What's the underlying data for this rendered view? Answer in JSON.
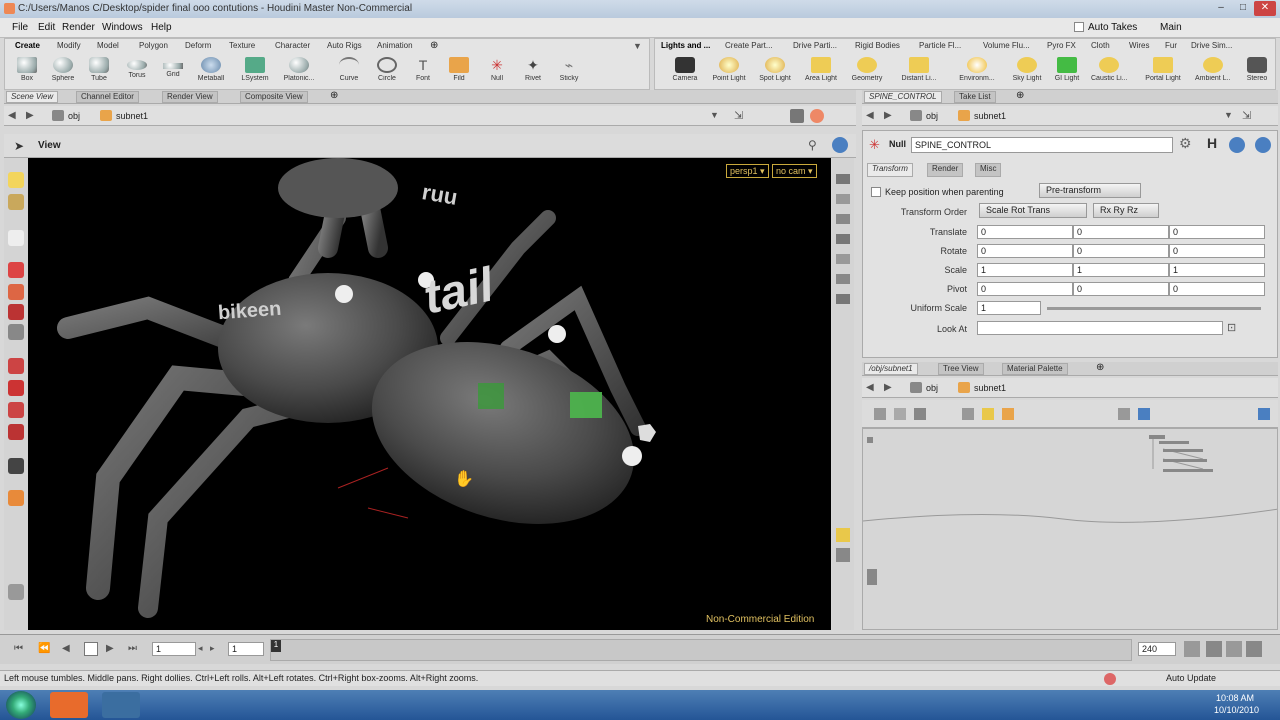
{
  "window": {
    "title": "C:/Users/Manos C/Desktop/spider final ooo contutions - Houdini Master Non-Commercial",
    "controls": [
      "–",
      "□",
      "✕"
    ]
  },
  "menubar": {
    "items": [
      "File",
      "Edit",
      "Render",
      "Windows",
      "Help"
    ],
    "auto_takes": "Auto Takes",
    "main": "Main"
  },
  "shelf_left": {
    "tabs": [
      "Create",
      "Modify",
      "Model",
      "Polygon",
      "Deform",
      "Texture",
      "Character",
      "Auto Rigs",
      "Animation"
    ],
    "tools": [
      "Box",
      "Sphere",
      "Tube",
      "Torus",
      "Grid",
      "Metaball",
      "LSystem",
      "Platonic...",
      "Curve",
      "Circle",
      "Font",
      "Fild",
      "Null",
      "Rivet",
      "Sticky"
    ]
  },
  "shelf_right": {
    "tabs": [
      "Lights and ...",
      "Create Part...",
      "Drive Parti...",
      "Rigid Bodies",
      "Particle Fl...",
      "Volume Flu...",
      "Pyro FX",
      "Cloth",
      "Wires",
      "Fur",
      "Drive Sim..."
    ],
    "tools": [
      "Camera",
      "Point Light",
      "Spot Light",
      "Area Light",
      "Geometry",
      "Distant Li...",
      "Environm...",
      "Sky Light",
      "GI Light",
      "Caustic Li...",
      "Portal Light",
      "Ambient L...",
      "Stereo"
    ]
  },
  "left_pane": {
    "tabs": [
      "Scene View",
      "Channel Editor",
      "Render View",
      "Composite View"
    ],
    "path_root": "obj",
    "path_node": "subnet1",
    "view_label": "View",
    "camera_menu": "persp1 ▾",
    "cam_menu": "no cam ▾",
    "watermark": "Non-Commercial Edition",
    "scene_labels": {
      "tail": "tail",
      "body": "bikeen",
      "head": "ruu"
    }
  },
  "right_top_pane": {
    "tabs": [
      "SPINE_CONTROL",
      "Take List"
    ],
    "path_root": "obj",
    "path_node": "subnet1",
    "node_type": "Null",
    "node_name": "SPINE_CONTROL",
    "param_tabs": [
      "Transform",
      "Render",
      "Misc"
    ],
    "keep_position": "Keep position when parenting",
    "pre_transform": "Pre-transform",
    "transform_order_label": "Transform Order",
    "transform_order": "Scale Rot Trans",
    "rot_order": "Rx Ry Rz",
    "rows": [
      {
        "label": "Translate",
        "values": [
          "0",
          "0",
          "0"
        ]
      },
      {
        "label": "Rotate",
        "values": [
          "0",
          "0",
          "0"
        ]
      },
      {
        "label": "Scale",
        "values": [
          "1",
          "1",
          "1"
        ]
      },
      {
        "label": "Pivot",
        "values": [
          "0",
          "0",
          "0"
        ]
      }
    ],
    "uniform_scale_label": "Uniform Scale",
    "uniform_scale": "1",
    "look_at_label": "Look At",
    "look_at": ""
  },
  "right_bottom_pane": {
    "tabs": [
      "/obj/subnet1",
      "Tree View",
      "Material Palette"
    ],
    "path_root": "obj",
    "path_node": "subnet1"
  },
  "timeline": {
    "frame": "1",
    "start": "1",
    "end": "240",
    "marker": "1"
  },
  "statusbar": {
    "hint": "Left mouse tumbles. Middle pans. Right dollies. Ctrl+Left rolls. Alt+Left rotates. Ctrl+Right box-zooms. Alt+Right zooms.",
    "auto_update": "Auto Update"
  },
  "taskbar": {
    "time": "10:08 AM",
    "date": "10/10/2010"
  }
}
